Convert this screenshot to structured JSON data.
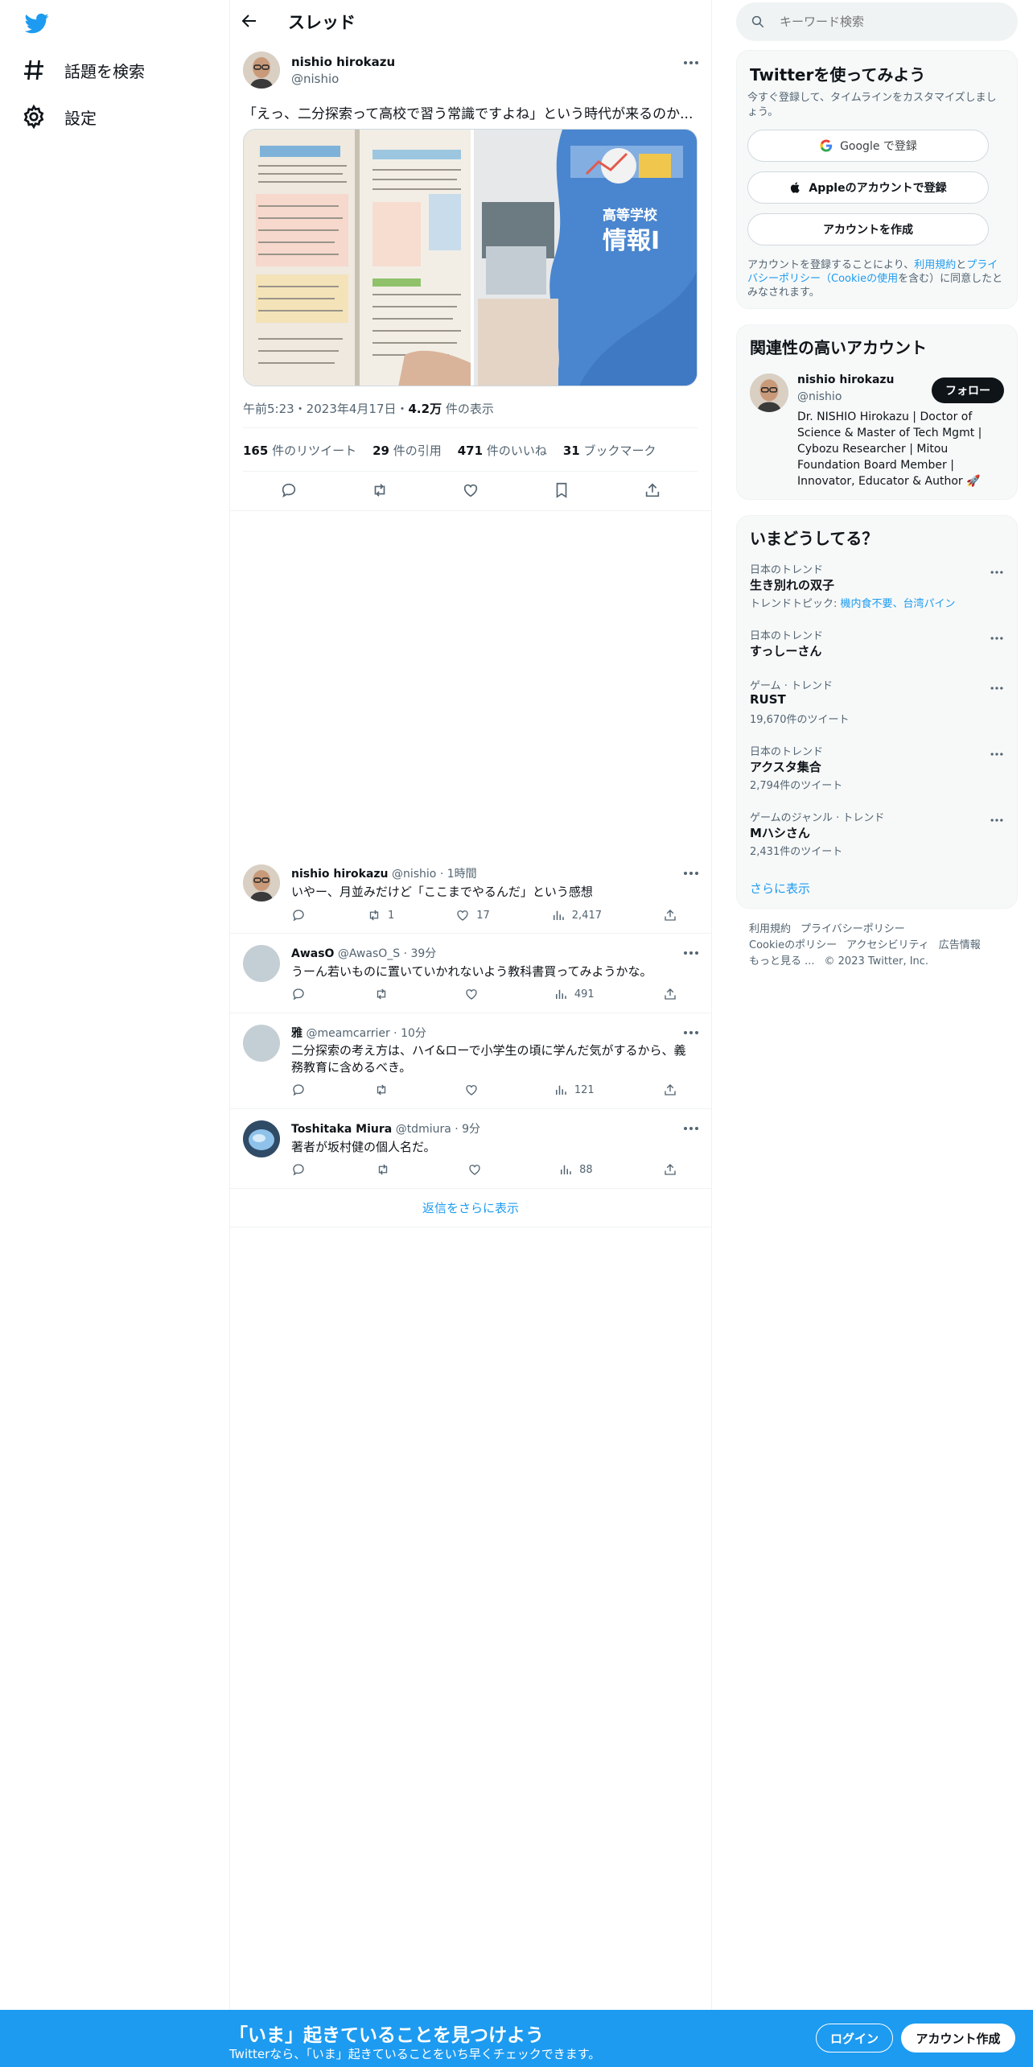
{
  "sidebar": {
    "logo": "twitter-bird-icon",
    "items": [
      {
        "label": "話題を検索",
        "icon": "hashtag-icon"
      },
      {
        "label": "設定",
        "icon": "gear-icon"
      }
    ]
  },
  "header": {
    "title": "スレッド"
  },
  "main_tweet": {
    "author_name": "nishio hirokazu",
    "author_handle": "@nishio",
    "text": "「えっ、二分探索って高校で習う常識ですよね」という時代が来るのか...",
    "media_title": "高等学校",
    "media_subtitle": "情報Ⅰ",
    "timestamp": "午前5:23・2023年4月17日・",
    "views_count": "4.2万",
    "views_label": " 件の表示",
    "retweets_count": "165",
    "retweets_label": " 件のリツイート",
    "quotes_count": "29",
    "quotes_label": " 件の引用",
    "likes_count": "471",
    "likes_label": " 件のいいね",
    "bookmarks_count": "31",
    "bookmarks_label": " ブックマーク"
  },
  "replies": [
    {
      "name": "nishio hirokazu",
      "meta": "@nishio · 1時間",
      "text": "いやー、月並みだけど「ここまでやるんだ」という感想",
      "retweets": "1",
      "likes": "17",
      "views": "2,417"
    },
    {
      "name": "AwasO",
      "meta": "@AwasO_S · 39分",
      "text": "うーん若いものに置いていかれないよう教科書買ってみようかな。",
      "retweets": "",
      "likes": "",
      "views": "491"
    },
    {
      "name": "雅",
      "meta": "@meamcarrier · 10分",
      "text": "二分探索の考え方は、ハイ&ローで小学生の頃に学んだ気がするから、義務教育に含めるべき。",
      "retweets": "",
      "likes": "",
      "views": "121"
    },
    {
      "name": "Toshitaka Miura",
      "meta": "@tdmiura · 9分",
      "text": "著者が坂村健の個人名だ。",
      "retweets": "",
      "likes": "",
      "views": "88"
    }
  ],
  "show_more_replies": "返信をさらに表示",
  "search": {
    "placeholder": "キーワード検索"
  },
  "signup_card": {
    "title": "Twitterを使ってみよう",
    "subtitle": "今すぐ登録して、タイムラインをカスタマイズしましょう。",
    "google_label": "Google で登録",
    "apple_label": "Appleのアカウントで登録",
    "create_label": "アカウントを作成",
    "legal_1": "アカウントを登録することにより、",
    "legal_terms": "利用規約",
    "legal_2": "と",
    "legal_privacy": "プライバシーポリシー（Cookieの使用",
    "legal_3": "を含む）に同意したとみなされます。"
  },
  "related": {
    "title": "関連性の高いアカウント",
    "name": "nishio hirokazu",
    "handle": "@nishio",
    "follow_label": "フォロー",
    "bio": "Dr. NISHIO Hirokazu | Doctor of Science & Master of Tech Mgmt | Cybozu Researcher | Mitou Foundation Board Member | Innovator, Educator & Author 🚀"
  },
  "trends": {
    "title": "いまどうしてる？",
    "items": [
      {
        "category": "日本のトレンド",
        "name": "生き別れの双子",
        "topics_label": "トレンドトピック: ",
        "topics": "機内食不要、台湾パイン",
        "count": ""
      },
      {
        "category": "日本のトレンド",
        "name": "すっしーさん",
        "topics_label": "",
        "topics": "",
        "count": ""
      },
      {
        "category": "ゲーム · トレンド",
        "name": "RUST",
        "topics_label": "",
        "topics": "",
        "count": "19,670件のツイート"
      },
      {
        "category": "日本のトレンド",
        "name": "アクスタ集合",
        "topics_label": "",
        "topics": "",
        "count": "2,794件のツイート"
      },
      {
        "category": "ゲームのジャンル · トレンド",
        "name": "Mハシさん",
        "topics_label": "",
        "topics": "",
        "count": "2,431件のツイート"
      }
    ],
    "show_more": "さらに表示"
  },
  "footer": {
    "terms": "利用規約",
    "privacy": "プライバシーポリシー",
    "cookie": "Cookieのポリシー",
    "accessibility": "アクセシビリティ",
    "ads": "広告情報",
    "more": "もっと見る ...",
    "copyright": "© 2023 Twitter, Inc."
  },
  "bottom_bar": {
    "title": "「いま」起きていることを見つけよう",
    "subtitle": "Twitterなら、「いま」起きていることをいち早くチェックできます。",
    "login_label": "ログイン",
    "signup_label": "アカウント作成"
  },
  "colors": {
    "accent": "#1d9bf0",
    "text": "#0f1419",
    "muted": "#536471",
    "border": "#eff3f4"
  }
}
